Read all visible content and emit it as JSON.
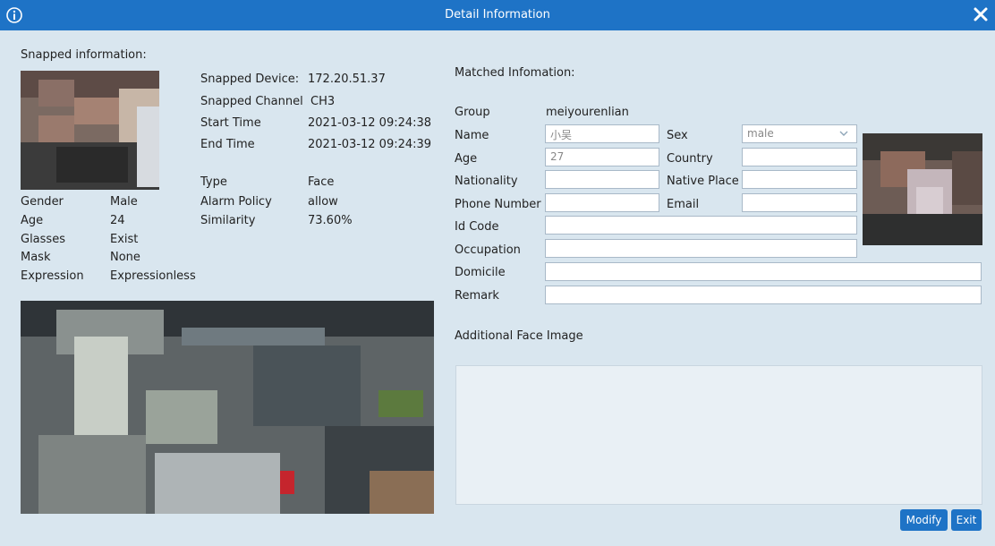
{
  "window": {
    "title": "Detail Information",
    "icons": {
      "info": "info-icon",
      "close": "close-icon"
    }
  },
  "snapped": {
    "heading": "Snapped information:",
    "device_label": "Snapped Device:",
    "device_value": "172.20.51.37",
    "channel_label": "Snapped Channel",
    "channel_value": "CH3",
    "start_label": "Start Time",
    "start_value": "2021-03-12 09:24:38",
    "end_label": "End Time",
    "end_value": "2021-03-12 09:24:39",
    "type_label": "Type",
    "type_value": "Face",
    "policy_label": "Alarm Policy",
    "policy_value": "allow",
    "similarity_label": "Similarity",
    "similarity_value": "73.60%",
    "attributes": [
      {
        "label": "Gender",
        "value": "Male"
      },
      {
        "label": "Age",
        "value": "24"
      },
      {
        "label": "Glasses",
        "value": "Exist"
      },
      {
        "label": "Mask",
        "value": "None"
      },
      {
        "label": "Expression",
        "value": "Expressionless"
      }
    ]
  },
  "matched": {
    "heading": "Matched Infomation:",
    "group_label": "Group",
    "group_value": "meiyourenlian",
    "name_label": "Name",
    "name_value": "小吴",
    "sex_label": "Sex",
    "sex_value": "male",
    "age_label": "Age",
    "age_value": "27",
    "country_label": "Country",
    "country_value": "",
    "nationality_label": "Nationality",
    "nationality_value": "",
    "native_place_label": "Native Place",
    "native_place_value": "",
    "phone_label": "Phone Number",
    "phone_value": "",
    "email_label": "Email",
    "email_value": "",
    "id_code_label": "Id Code",
    "id_code_value": "",
    "occupation_label": "Occupation",
    "occupation_value": "",
    "domicile_label": "Domicile",
    "domicile_value": "",
    "remark_label": "Remark",
    "remark_value": ""
  },
  "additional": {
    "heading": "Additional Face Image"
  },
  "buttons": {
    "modify": "Modify",
    "exit": "Exit"
  },
  "colors": {
    "titlebar": "#1e73c6",
    "background": "#d9e6ef",
    "button": "#1e73c6"
  }
}
